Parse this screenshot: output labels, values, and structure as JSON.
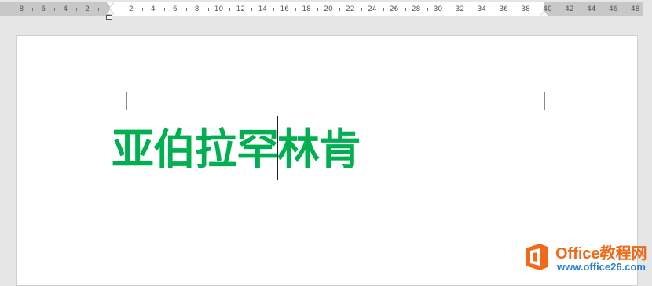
{
  "ruler": {
    "ticks": [
      "8",
      "6",
      "4",
      "2",
      "2",
      "4",
      "6",
      "8",
      "10",
      "12",
      "14",
      "16",
      "18",
      "20",
      "22",
      "24",
      "26",
      "28",
      "30",
      "32",
      "34",
      "36",
      "38",
      "40",
      "42",
      "44",
      "46",
      "48"
    ]
  },
  "document": {
    "text_before_cursor": "亚伯拉罕",
    "text_after_cursor": "林肯",
    "text_color": "#00b050"
  },
  "watermark": {
    "brand": "Office教程网",
    "url": "www.office26.com",
    "logo_color": "#f06a1c"
  }
}
